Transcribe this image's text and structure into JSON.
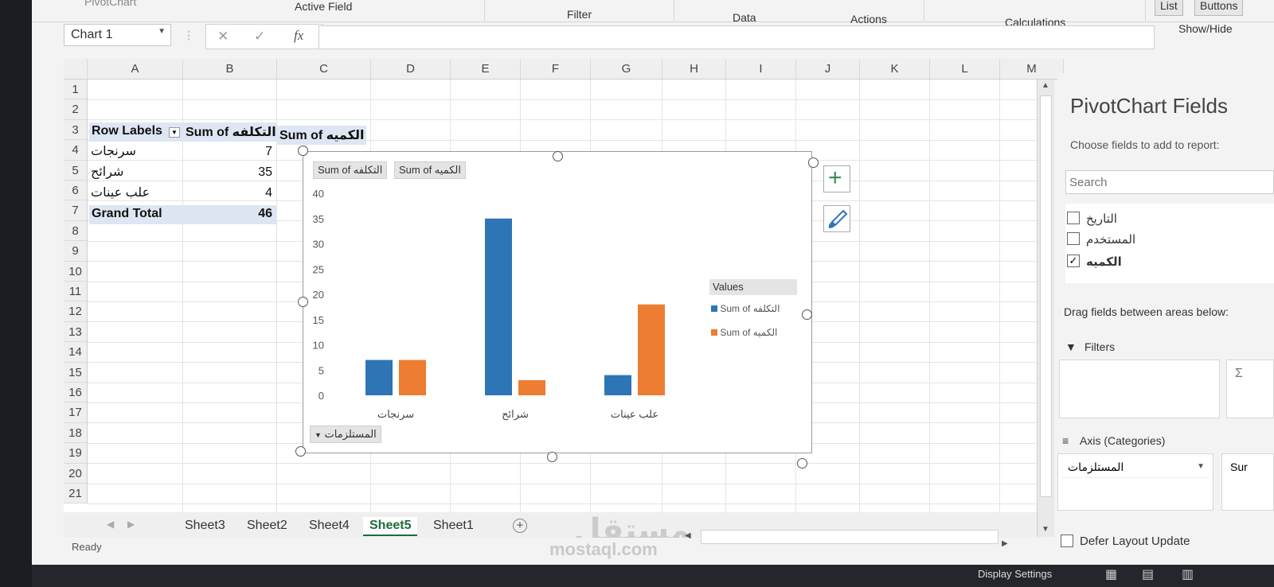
{
  "ribbon": {
    "groups": [
      "PivotChart",
      "Active Field",
      "Filter",
      "Data",
      "Actions",
      "Calculations",
      "Show/Hide"
    ],
    "buttons": [
      "List",
      "Buttons"
    ]
  },
  "formula_bar": {
    "name_box": "Chart 1",
    "cancel": "✕",
    "enter": "✓",
    "fx": "fx"
  },
  "sheet": {
    "columns": [
      "A",
      "B",
      "C",
      "D",
      "E",
      "F",
      "G",
      "H",
      "I",
      "J",
      "K",
      "L",
      "M"
    ],
    "rows": [
      "1",
      "2",
      "3",
      "4",
      "5",
      "6",
      "7",
      "8",
      "9",
      "10",
      "11",
      "12",
      "13",
      "14",
      "15",
      "16",
      "17",
      "18",
      "19",
      "20",
      "21"
    ],
    "pivot": {
      "header_row_labels": "Row Labels",
      "header_sum_cost": "Sum of التكلفه",
      "header_sum_qty": "Sum of الكميه",
      "rows": [
        {
          "label": "سرنجات",
          "value": "7"
        },
        {
          "label": "شرائح",
          "value": "35"
        },
        {
          "label": "علب عينات",
          "value": "4"
        }
      ],
      "grand_total_label": "Grand Total",
      "grand_total_value": "46"
    }
  },
  "chart_data": {
    "type": "bar",
    "categories": [
      "سرنجات",
      "شرائح",
      "علب عينات"
    ],
    "series": [
      {
        "name": "Sum of التكلفه",
        "values": [
          7,
          35,
          4
        ],
        "color": "#2e75b6"
      },
      {
        "name": "Sum of الكميه",
        "values": [
          7,
          3,
          18
        ],
        "color": "#ed7d31"
      }
    ],
    "ylim": [
      0,
      40
    ],
    "yticks": [
      "40",
      "35",
      "30",
      "25",
      "20",
      "15",
      "10",
      "5",
      "0"
    ],
    "legend_title": "Values",
    "legend_placement": "right",
    "field_buttons": [
      "Sum of التكلفه",
      "Sum of الكميه"
    ],
    "axis_field_button": "المستلزمات"
  },
  "sheet_tabs": [
    "Sheet3",
    "Sheet2",
    "Sheet4",
    "Sheet5",
    "Sheet1"
  ],
  "active_tab": "Sheet5",
  "status": "Ready",
  "watermark": {
    "arabic": "مستقل",
    "url": "mostaql.com"
  },
  "pivot_pane": {
    "title": "PivotChart Fields",
    "subtitle": "Choose fields to add to report:",
    "search_placeholder": "Search",
    "fields": [
      {
        "label": "التاريخ",
        "checked": false
      },
      {
        "label": "المستخدم",
        "checked": false
      },
      {
        "label": "الكميه",
        "checked": true
      }
    ],
    "drag_hint": "Drag fields between areas below:",
    "filters_label": "Filters",
    "axis_label": "Axis (Categories)",
    "axis_field": "المستلزمات",
    "values_partial": "Sur",
    "defer_label": "Defer Layout Update"
  },
  "taskbar": {
    "display_settings": "Display Settings"
  }
}
